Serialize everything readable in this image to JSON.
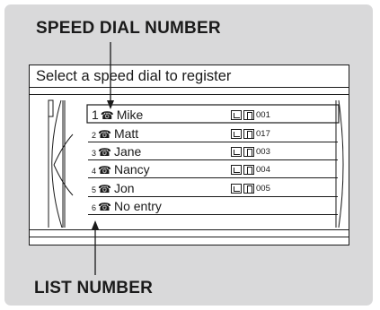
{
  "callouts": {
    "top": "SPEED DIAL NUMBER",
    "bottom": "LIST NUMBER"
  },
  "screen": {
    "title": "Select a speed dial to register",
    "entries": [
      {
        "index": "1",
        "name": "Mike",
        "code": "001",
        "selected": true
      },
      {
        "index": "2",
        "name": "Matt",
        "code": "017",
        "selected": false
      },
      {
        "index": "3",
        "name": "Jane",
        "code": "003",
        "selected": false
      },
      {
        "index": "4",
        "name": "Nancy",
        "code": "004",
        "selected": false
      },
      {
        "index": "5",
        "name": "Jon",
        "code": "005",
        "selected": false
      },
      {
        "index": "6",
        "name": "No entry",
        "code": "",
        "selected": false
      }
    ]
  },
  "icons": {
    "phone": "phone-icon",
    "entry_type": "contact-icon",
    "mobile": "mobile-icon"
  }
}
